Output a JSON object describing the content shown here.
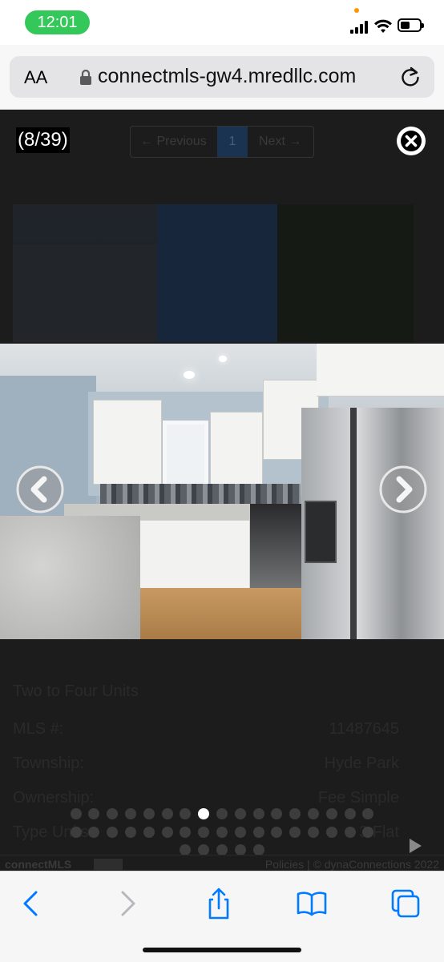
{
  "status_bar": {
    "time": "12:01"
  },
  "address_bar": {
    "text_size_label": "AA",
    "url": "connectmls-gw4.mredllc.com"
  },
  "lightbox": {
    "counter": "(8/39)",
    "pager": {
      "prev_label": "← Previous",
      "page_number": "1",
      "next_label": "Next →"
    },
    "photo_index": 8,
    "photo_total": 39
  },
  "listing": {
    "title": "Two to Four Units",
    "fields": [
      {
        "label": "MLS #:",
        "value": "11487645"
      },
      {
        "label": "Township:",
        "value": "Hyde Park"
      },
      {
        "label": "Ownership:",
        "value": "Fee Simple"
      },
      {
        "label": "Type Units:",
        "value": "3 Flat"
      }
    ]
  },
  "footer": {
    "brand": "connectMLS",
    "links": "Policies | © dynaConnections 2022"
  },
  "colors": {
    "time_pill": "#34c759",
    "ios_blue": "#007aff"
  }
}
